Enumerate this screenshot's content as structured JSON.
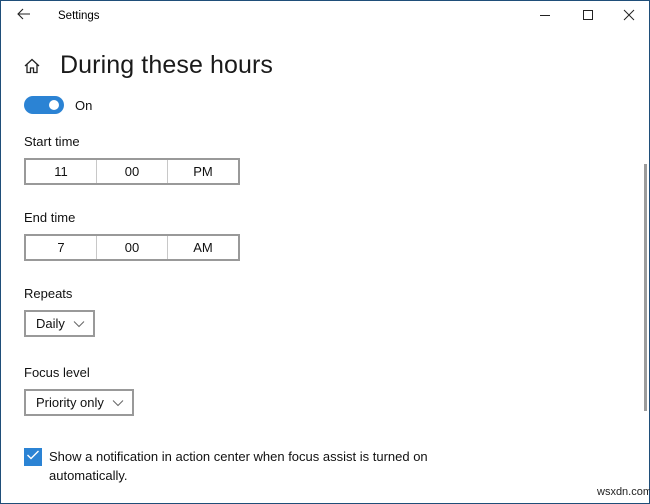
{
  "window": {
    "title": "Settings",
    "controls": {
      "back_icon": "arrow-left-icon",
      "minimize_icon": "minimize-icon",
      "maximize_icon": "maximize-icon",
      "close_icon": "close-icon"
    }
  },
  "header": {
    "home_icon": "home-icon",
    "title": "During these hours"
  },
  "toggle": {
    "state": "on",
    "label": "On",
    "accent_color": "#2b83d4"
  },
  "start_time": {
    "label": "Start time",
    "hour": "11",
    "minute": "00",
    "period": "PM"
  },
  "end_time": {
    "label": "End time",
    "hour": "7",
    "minute": "00",
    "period": "AM"
  },
  "repeats": {
    "label": "Repeats",
    "selected": "Daily"
  },
  "focus_level": {
    "label": "Focus level",
    "selected": "Priority only"
  },
  "notification_checkbox": {
    "checked": true,
    "label": "Show a notification in action center when focus assist is turned on automatically."
  },
  "watermark": "wsxdn.com"
}
